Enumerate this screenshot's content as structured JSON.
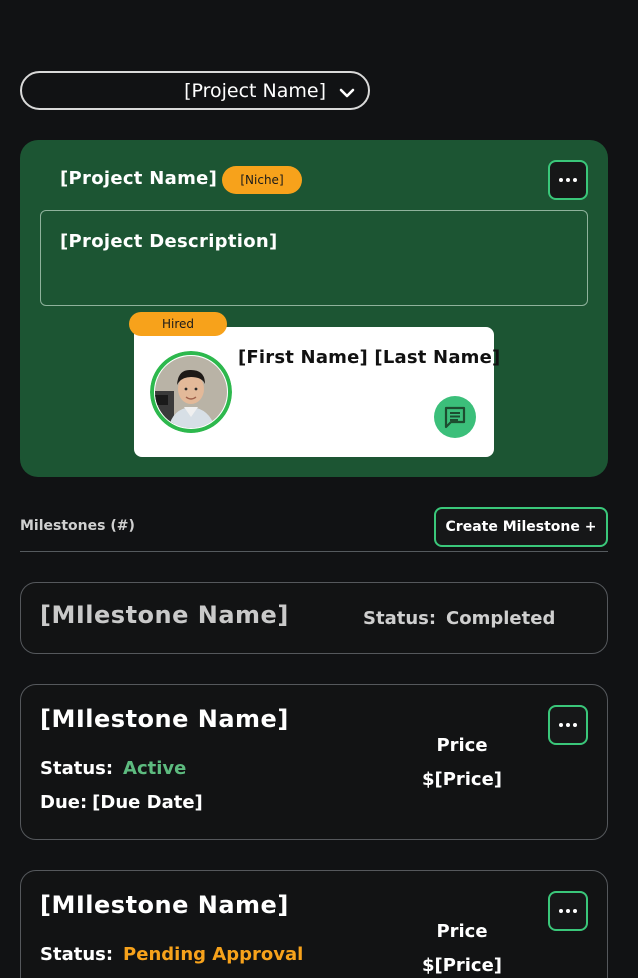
{
  "selector": {
    "value": "[Project Name]",
    "icon": "chevron-down-icon"
  },
  "project": {
    "name": "[Project Name]",
    "niche": "[Niche]",
    "description": "[Project Description]",
    "hired_badge": "Hired",
    "freelancer_name": "[First Name] [Last Name]",
    "colors": {
      "card": "#1c5533",
      "badge": "#f7a21b",
      "accent": "#3ac77a"
    }
  },
  "milestones_section": {
    "heading": "Milestones (#)",
    "create_button": "Create Milestone +"
  },
  "milestones": [
    {
      "name": "[MIlestone Name]",
      "status_label": "Status:",
      "status": "Completed",
      "status_color": "#cfcfcf"
    },
    {
      "name": "[MIlestone Name]",
      "status_label": "Status:",
      "status": "Active",
      "status_color": "#5dbb7f",
      "due_label": "Due:",
      "due": "[Due Date]",
      "price_label": "Price",
      "price": "$[Price]"
    },
    {
      "name": "[MIlestone Name]",
      "status_label": "Status:",
      "status": "Pending Approval",
      "status_color": "#f7a21b",
      "price_label": "Price",
      "price": "$[Price]"
    }
  ]
}
